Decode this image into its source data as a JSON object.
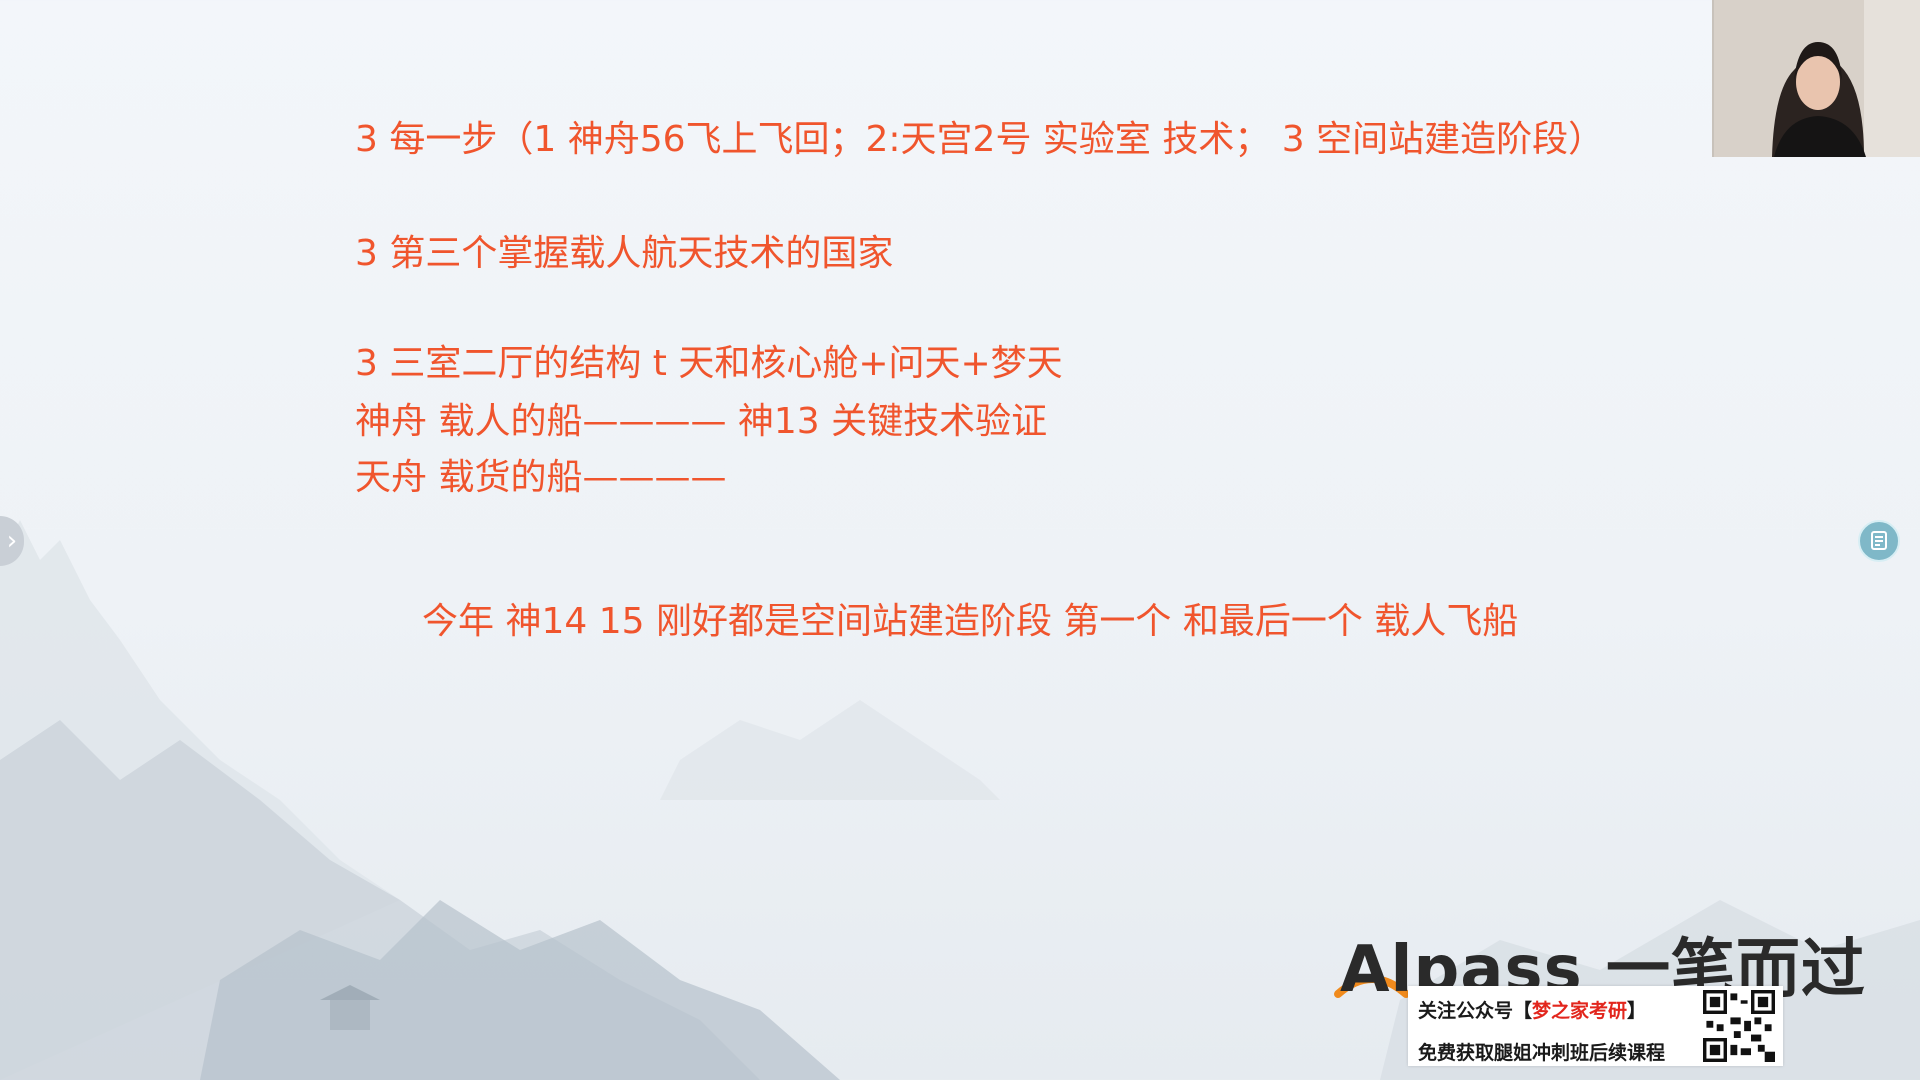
{
  "slide": {
    "lines": [
      "3  每一步（1 神舟56飞上飞回；2:天宫2号 实验室 技术；  3 空间站建造阶段）",
      "3 第三个掌握载人航天技术的国家",
      "3 三室二厅的结构 t 天和核心舱+问天+梦天",
      "神舟  载人的船———— 神13 关键技术验证",
      "天舟  载货的船————",
      "今年  神14  15  刚好都是空间站建造阶段 第一个  和最后一个 载人飞船"
    ]
  },
  "logo": {
    "text": "Alpass 一笔而过"
  },
  "promo": {
    "prefix": "关注公众号【",
    "account": "梦之家考研",
    "suffix": "】",
    "subtitle": "免费获取腿姐冲刺班后续课程"
  },
  "colors": {
    "slide_text": "#f0552d",
    "promo_accent": "#e2261d",
    "logo_arc": "#f08a1c"
  },
  "icons": {
    "left_nav": "chevron-right-icon",
    "note": "note-icon",
    "qr": "qr-code-icon"
  }
}
